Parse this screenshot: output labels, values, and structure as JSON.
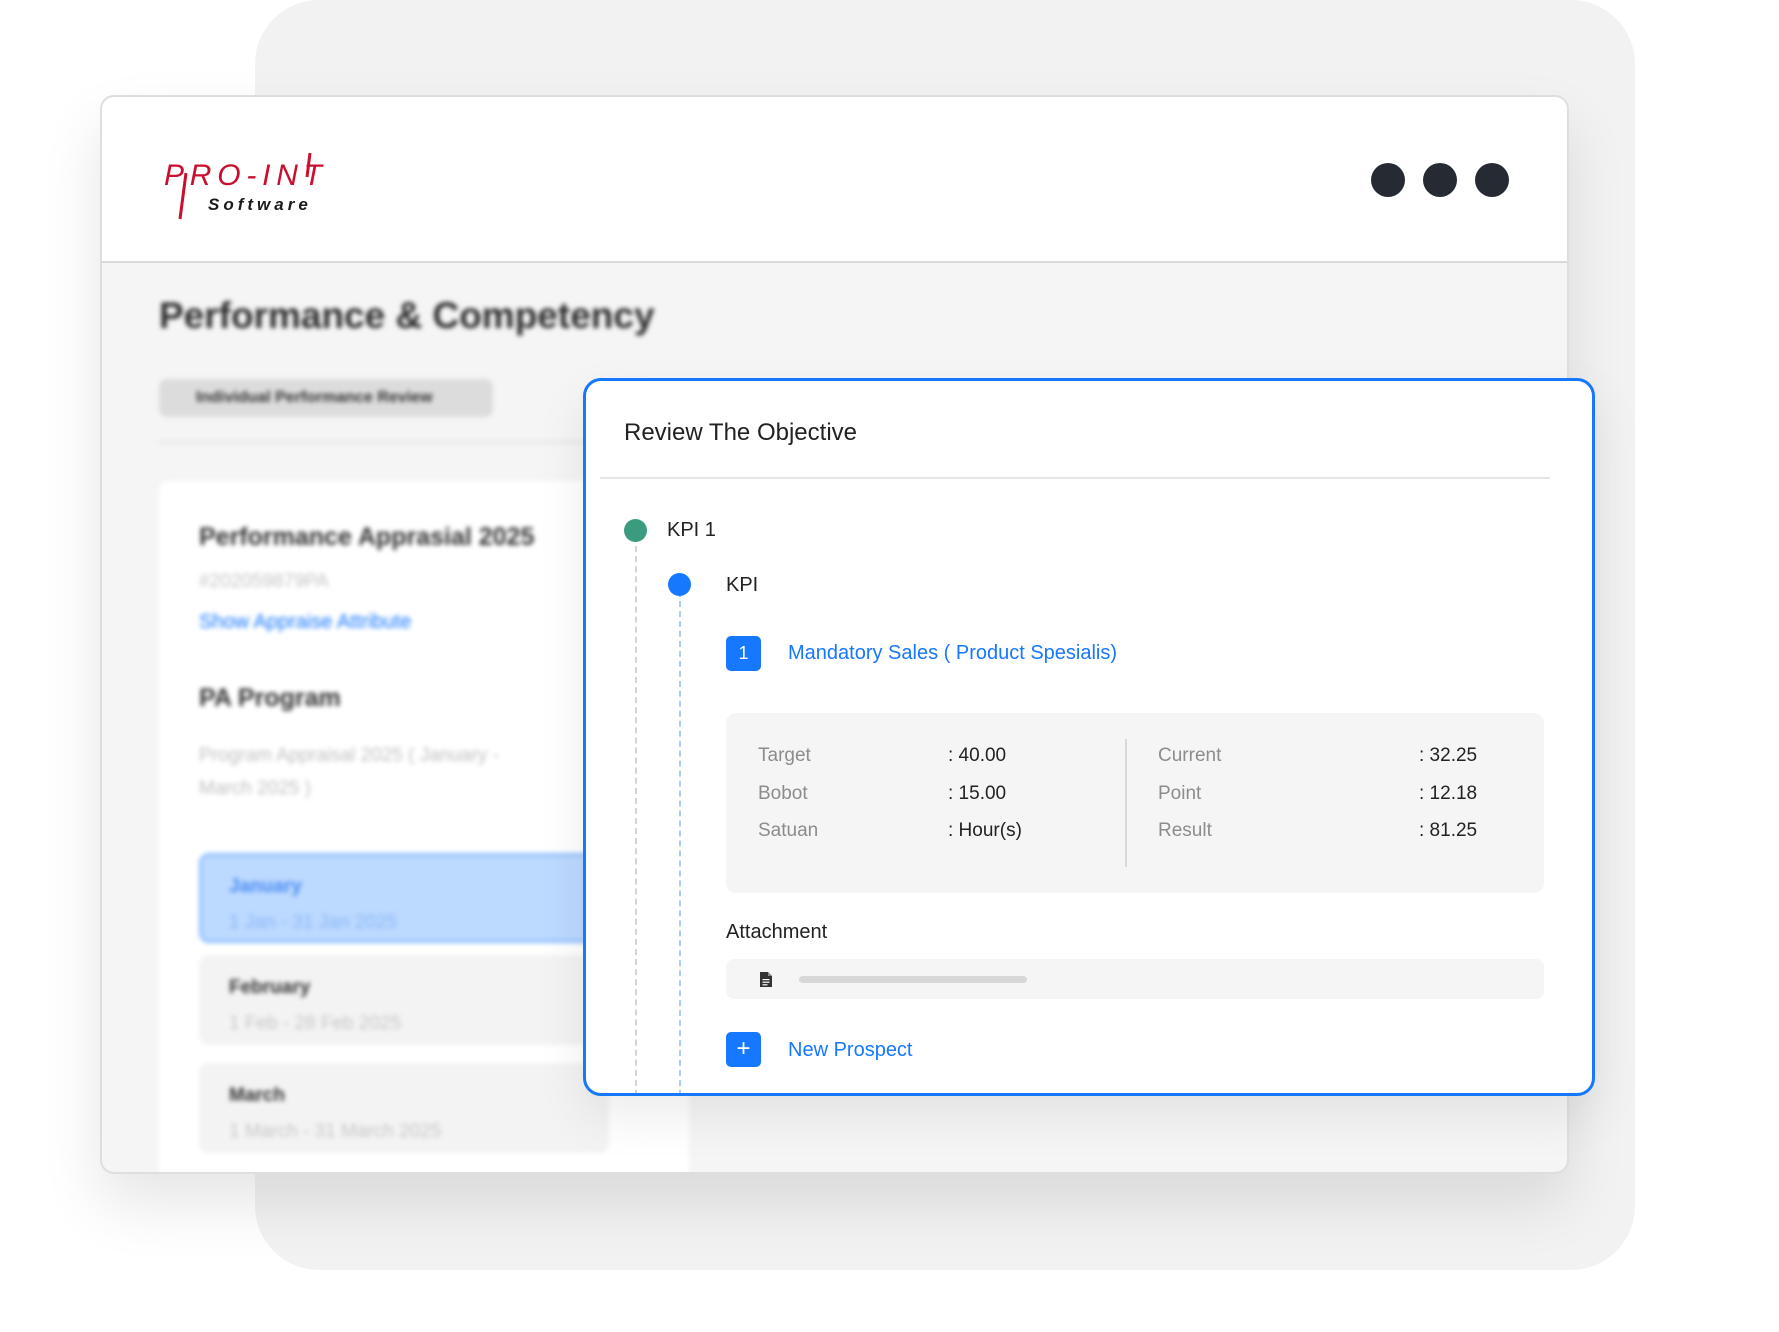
{
  "brand": {
    "logo_text": "PRO-INT",
    "logo_subtext": "Software",
    "logo_color": "#c8102e"
  },
  "page": {
    "title": "Performance & Competency",
    "tab_label": "Individual Performance Review"
  },
  "appraisal": {
    "title": "Performance Apprasial 2025",
    "code": "#202059879PA",
    "show_attribute_link": "Show Appraise Attribute",
    "program_heading": "PA Program",
    "program_desc": "Program Appraisal 2025 ( January - March 2025 )",
    "months": [
      {
        "name": "January",
        "range": "1 Jan - 31 Jan 2025",
        "active": true
      },
      {
        "name": "February",
        "range": "1 Feb - 28 Feb 2025",
        "active": false
      },
      {
        "name": "March",
        "range": "1 March - 31 March 2025",
        "active": false
      }
    ]
  },
  "modal": {
    "title": "Review The Objective",
    "kpi_group": "KPI 1",
    "kpi_sub": "KPI",
    "item": {
      "number": "1",
      "name": "Mandatory Sales ( Product Spesialis)",
      "stats_left": [
        {
          "label": "Target",
          "value": ": 40.00"
        },
        {
          "label": "Bobot",
          "value": ": 15.00"
        },
        {
          "label": "Satuan",
          "value": ": Hour(s)"
        }
      ],
      "stats_right": [
        {
          "label": "Current",
          "value": ": 32.25"
        },
        {
          "label": "Point",
          "value": ": 12.18"
        },
        {
          "label": "Result",
          "value": ": 81.25"
        }
      ]
    },
    "attachment_label": "Attachment",
    "add_icon": "+",
    "new_prospect_label": "New Prospect"
  },
  "colors": {
    "accent": "#1677ff",
    "kpi_group_node": "#3a9b7e",
    "window_dots": "#262b33"
  },
  "icons": [
    "logo-mark",
    "window-dot",
    "file-icon",
    "plus-icon"
  ]
}
